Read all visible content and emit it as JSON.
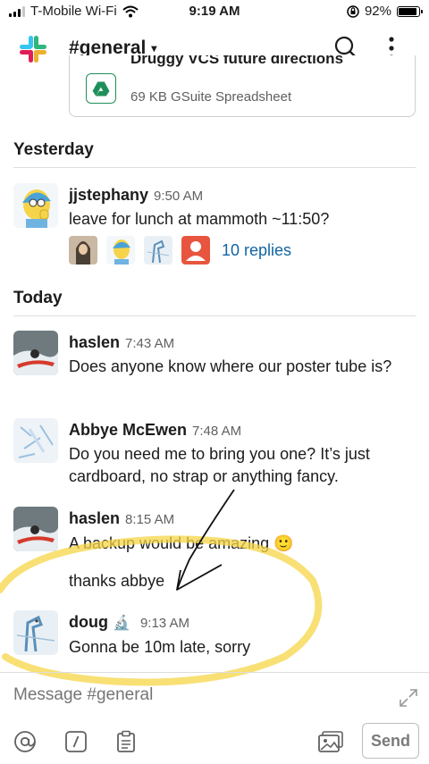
{
  "status_bar": {
    "carrier": "T-Mobile Wi-Fi",
    "time": "9:19 AM",
    "battery_percent": "92%",
    "battery_level": 0.92
  },
  "header": {
    "channel_name": "#general",
    "logo_icon": "slack-logo-icon",
    "search_icon": "search-icon",
    "more_icon": "more-vertical-icon"
  },
  "file_card": {
    "title": "Druggy VCS future directions",
    "meta": "69 KB GSuite Spreadsheet",
    "icon": "google-drive-icon"
  },
  "sections": {
    "yesterday": {
      "label": "Yesterday",
      "message": {
        "author": "jjstephany",
        "time": "9:50 AM",
        "text": "leave for lunch at mammoth ~11:50?",
        "replies_label": "10 replies"
      }
    },
    "today": {
      "label": "Today",
      "messages": [
        {
          "author": "haslen",
          "time": "7:43 AM",
          "text": "Does anyone know where our poster tube is?"
        },
        {
          "author": "Abbye McEwen",
          "time": "7:48 AM",
          "text": "Do you need me to bring you one?  It’s just cardboard, no strap or anything fancy."
        },
        {
          "author": "haslen",
          "time": "8:15 AM",
          "text": "A backup would be amazing",
          "emoji": "🙂",
          "text2": "thanks abbye"
        },
        {
          "author": "doug",
          "status_emoji": "🔬",
          "time": "9:13 AM",
          "text": "Gonna be 10m late, sorry"
        }
      ]
    }
  },
  "composer": {
    "placeholder": "Message #general",
    "send_label": "Send",
    "icons": [
      "at-mention-icon",
      "slash-command-icon",
      "clipboard-icon",
      "image-attach-icon",
      "expand-icon"
    ]
  },
  "colors": {
    "link": "#1264a3",
    "annotation_highlight": "#f5d547",
    "drive_green": "#1f8f5a"
  }
}
